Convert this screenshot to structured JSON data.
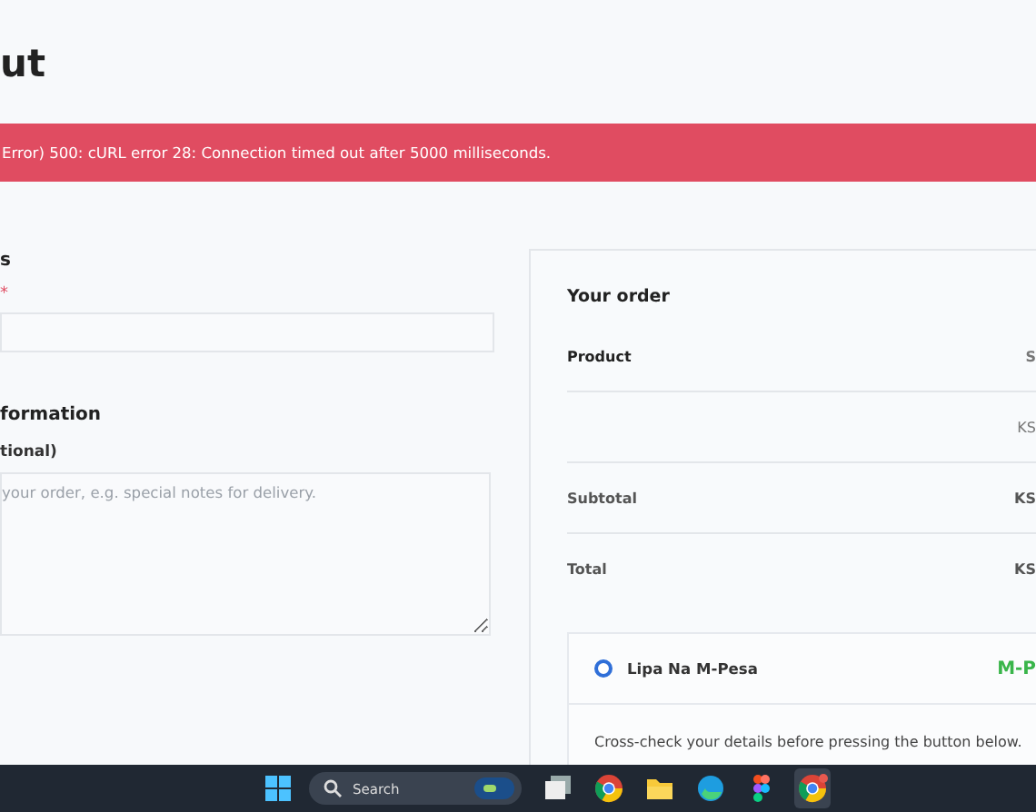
{
  "page_title": "ut",
  "error_banner": "Error) 500: cURL error 28: Connection timed out after 5000 milliseconds.",
  "billing": {
    "heading": "s",
    "required_mark": "*"
  },
  "additional": {
    "heading": "formation",
    "label": "tional)",
    "placeholder": "your order, e.g. special notes for delivery."
  },
  "order": {
    "title": "Your order",
    "header": {
      "label": "Product",
      "value": "S"
    },
    "rows": [
      {
        "kind": "item",
        "label": "",
        "value": "KS"
      },
      {
        "kind": "subtotal",
        "label": "Subtotal",
        "value": "KS"
      },
      {
        "kind": "total",
        "label": "Total",
        "value": "KS"
      }
    ]
  },
  "payment": {
    "methods": [
      {
        "label": "Lipa Na M-Pesa",
        "selected": true,
        "logo_text": "M-P"
      }
    ],
    "description": [
      "Cross-check your details before pressing the button below."
    ]
  },
  "taskbar": {
    "search_placeholder": "Search",
    "apps": [
      {
        "kind": "taskview",
        "active": false
      },
      {
        "kind": "chrome",
        "active": false
      },
      {
        "kind": "folder",
        "active": false
      },
      {
        "kind": "edge",
        "active": false
      },
      {
        "kind": "figma",
        "active": false
      },
      {
        "kind": "chrome",
        "active": true
      }
    ]
  }
}
